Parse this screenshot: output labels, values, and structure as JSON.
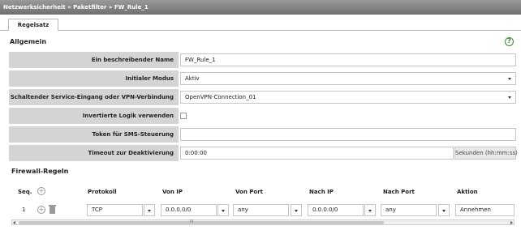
{
  "breadcrumb": "Netzwerksicherheit » Paketfilter » FW_Rule_1",
  "tabs": [
    {
      "label": "Regelsatz"
    }
  ],
  "general": {
    "title": "Allgemein",
    "fields": [
      {
        "label": "Ein beschreibender Name",
        "value": "FW_Rule_1"
      },
      {
        "label": "Initialer Modus",
        "value": "Aktiv"
      },
      {
        "label": "Schaltender Service-Eingang oder VPN-Verbindung",
        "value": "OpenVPN-Connection_01"
      },
      {
        "label": "Invertierte Logik verwenden",
        "checked": false
      },
      {
        "label": "Token für SMS-Steuerung",
        "value": ""
      },
      {
        "label": "Timeout zur Deaktivierung",
        "value": "0:00:00",
        "suffix": "Sekunden (hh:mm:ss)"
      }
    ]
  },
  "firewall": {
    "title": "Firewall-Regeln",
    "columns": [
      "Seq.",
      "Protokoll",
      "Von IP",
      "Von Port",
      "Nach IP",
      "Nach Port",
      "Aktion"
    ],
    "rows": [
      {
        "seq": "1",
        "protocol": "TCP",
        "from_ip": "0.0.0.0/0",
        "from_port": "any",
        "to_ip": "0.0.0.0/0",
        "to_port": "any",
        "action": "Annehmen"
      }
    ]
  },
  "scrollbar": {
    "grip": "III"
  }
}
